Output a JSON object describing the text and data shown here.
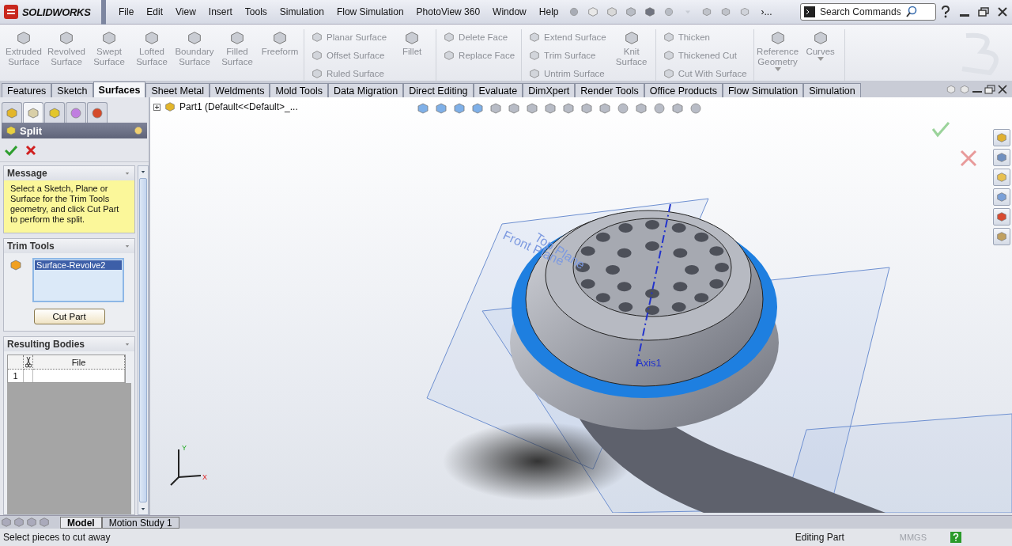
{
  "app": {
    "logo": "SOLIDWORKS",
    "menu": [
      "File",
      "Edit",
      "View",
      "Insert",
      "Tools",
      "Simulation",
      "Flow Simulation",
      "PhotoView 360",
      "Window",
      "Help"
    ],
    "overflow": "›...",
    "search": {
      "placeholder": "Search Commands"
    }
  },
  "ribbon": [
    {
      "items": [
        {
          "kind": "big",
          "label": "Extruded Surface",
          "disabled": true
        },
        {
          "kind": "big",
          "label": "Revolved Surface",
          "disabled": true
        },
        {
          "kind": "big",
          "label": "Swept Surface",
          "disabled": true
        },
        {
          "kind": "big",
          "label": "Lofted Surface",
          "disabled": true
        },
        {
          "kind": "big",
          "label": "Boundary Surface",
          "disabled": true
        },
        {
          "kind": "big",
          "label": "Filled Surface",
          "disabled": true
        },
        {
          "kind": "big",
          "label": "Freeform",
          "disabled": true
        }
      ]
    },
    {
      "items": [
        {
          "kind": "stack",
          "items": [
            {
              "label": "Planar Surface",
              "disabled": true
            },
            {
              "label": "Offset Surface",
              "disabled": true
            },
            {
              "label": "Ruled Surface",
              "disabled": true
            }
          ]
        },
        {
          "kind": "big",
          "label": "Fillet",
          "disabled": true
        }
      ]
    },
    {
      "items": [
        {
          "kind": "stack",
          "items": [
            {
              "label": "Delete Face",
              "disabled": true
            },
            {
              "label": "Replace Face",
              "disabled": true
            }
          ]
        }
      ]
    },
    {
      "items": [
        {
          "kind": "stack",
          "items": [
            {
              "label": "Extend Surface",
              "disabled": true
            },
            {
              "label": "Trim Surface",
              "disabled": true
            },
            {
              "label": "Untrim Surface",
              "disabled": true
            }
          ]
        },
        {
          "kind": "big",
          "label": "Knit Surface",
          "disabled": true
        }
      ]
    },
    {
      "items": [
        {
          "kind": "stack",
          "items": [
            {
              "label": "Thicken",
              "disabled": true
            },
            {
              "label": "Thickened Cut",
              "disabled": true
            },
            {
              "label": "Cut With Surface",
              "disabled": true
            }
          ]
        }
      ]
    },
    {
      "items": [
        {
          "kind": "big",
          "label": "Reference Geometry",
          "disabled": true,
          "dropdown": true
        },
        {
          "kind": "big",
          "label": "Curves",
          "disabled": true,
          "dropdown": true
        }
      ]
    }
  ],
  "command_tabs": [
    {
      "label": "Features",
      "selected": false
    },
    {
      "label": "Sketch",
      "selected": false
    },
    {
      "label": "Surfaces",
      "selected": true
    },
    {
      "label": "Sheet Metal",
      "selected": false
    },
    {
      "label": "Weldments",
      "selected": false
    },
    {
      "label": "Mold Tools",
      "selected": false
    },
    {
      "label": "Data Migration",
      "selected": false
    },
    {
      "label": "Direct Editing",
      "selected": false
    },
    {
      "label": "Evaluate",
      "selected": false
    },
    {
      "label": "DimXpert",
      "selected": false
    },
    {
      "label": "Render Tools",
      "selected": false
    },
    {
      "label": "Office Products",
      "selected": false
    },
    {
      "label": "Flow Simulation",
      "selected": false
    },
    {
      "label": "Simulation",
      "selected": false
    }
  ],
  "property_manager": {
    "title": "Split",
    "message": {
      "title": "Message",
      "text": "Select a Sketch, Plane or Surface for the Trim Tools geometry, and click Cut Part to perform the split."
    },
    "trim_tools": {
      "title": "Trim Tools",
      "items": [
        {
          "label": "Surface-Revolve2",
          "selected": true
        }
      ],
      "button": "Cut Part"
    },
    "resulting_bodies": {
      "title": "Resulting Bodies",
      "columns": [
        "File"
      ],
      "rows": [
        "1"
      ]
    }
  },
  "tree": {
    "label": "Part1  (Default<<Default>_..."
  },
  "viewport": {
    "triad": [
      "Y",
      "X"
    ],
    "labels": [
      {
        "kind": "plane",
        "text": "Front Plane"
      },
      {
        "kind": "plane",
        "text": "Top Plane"
      },
      {
        "kind": "axis",
        "text": "Axis1"
      }
    ]
  },
  "bottom_tabs": [
    {
      "label": "Model",
      "selected": true
    },
    {
      "label": "Motion Study 1",
      "selected": false
    }
  ],
  "status_bar": {
    "message": "Select pieces to cut away",
    "mode": "Editing Part",
    "units": "MMGS"
  }
}
